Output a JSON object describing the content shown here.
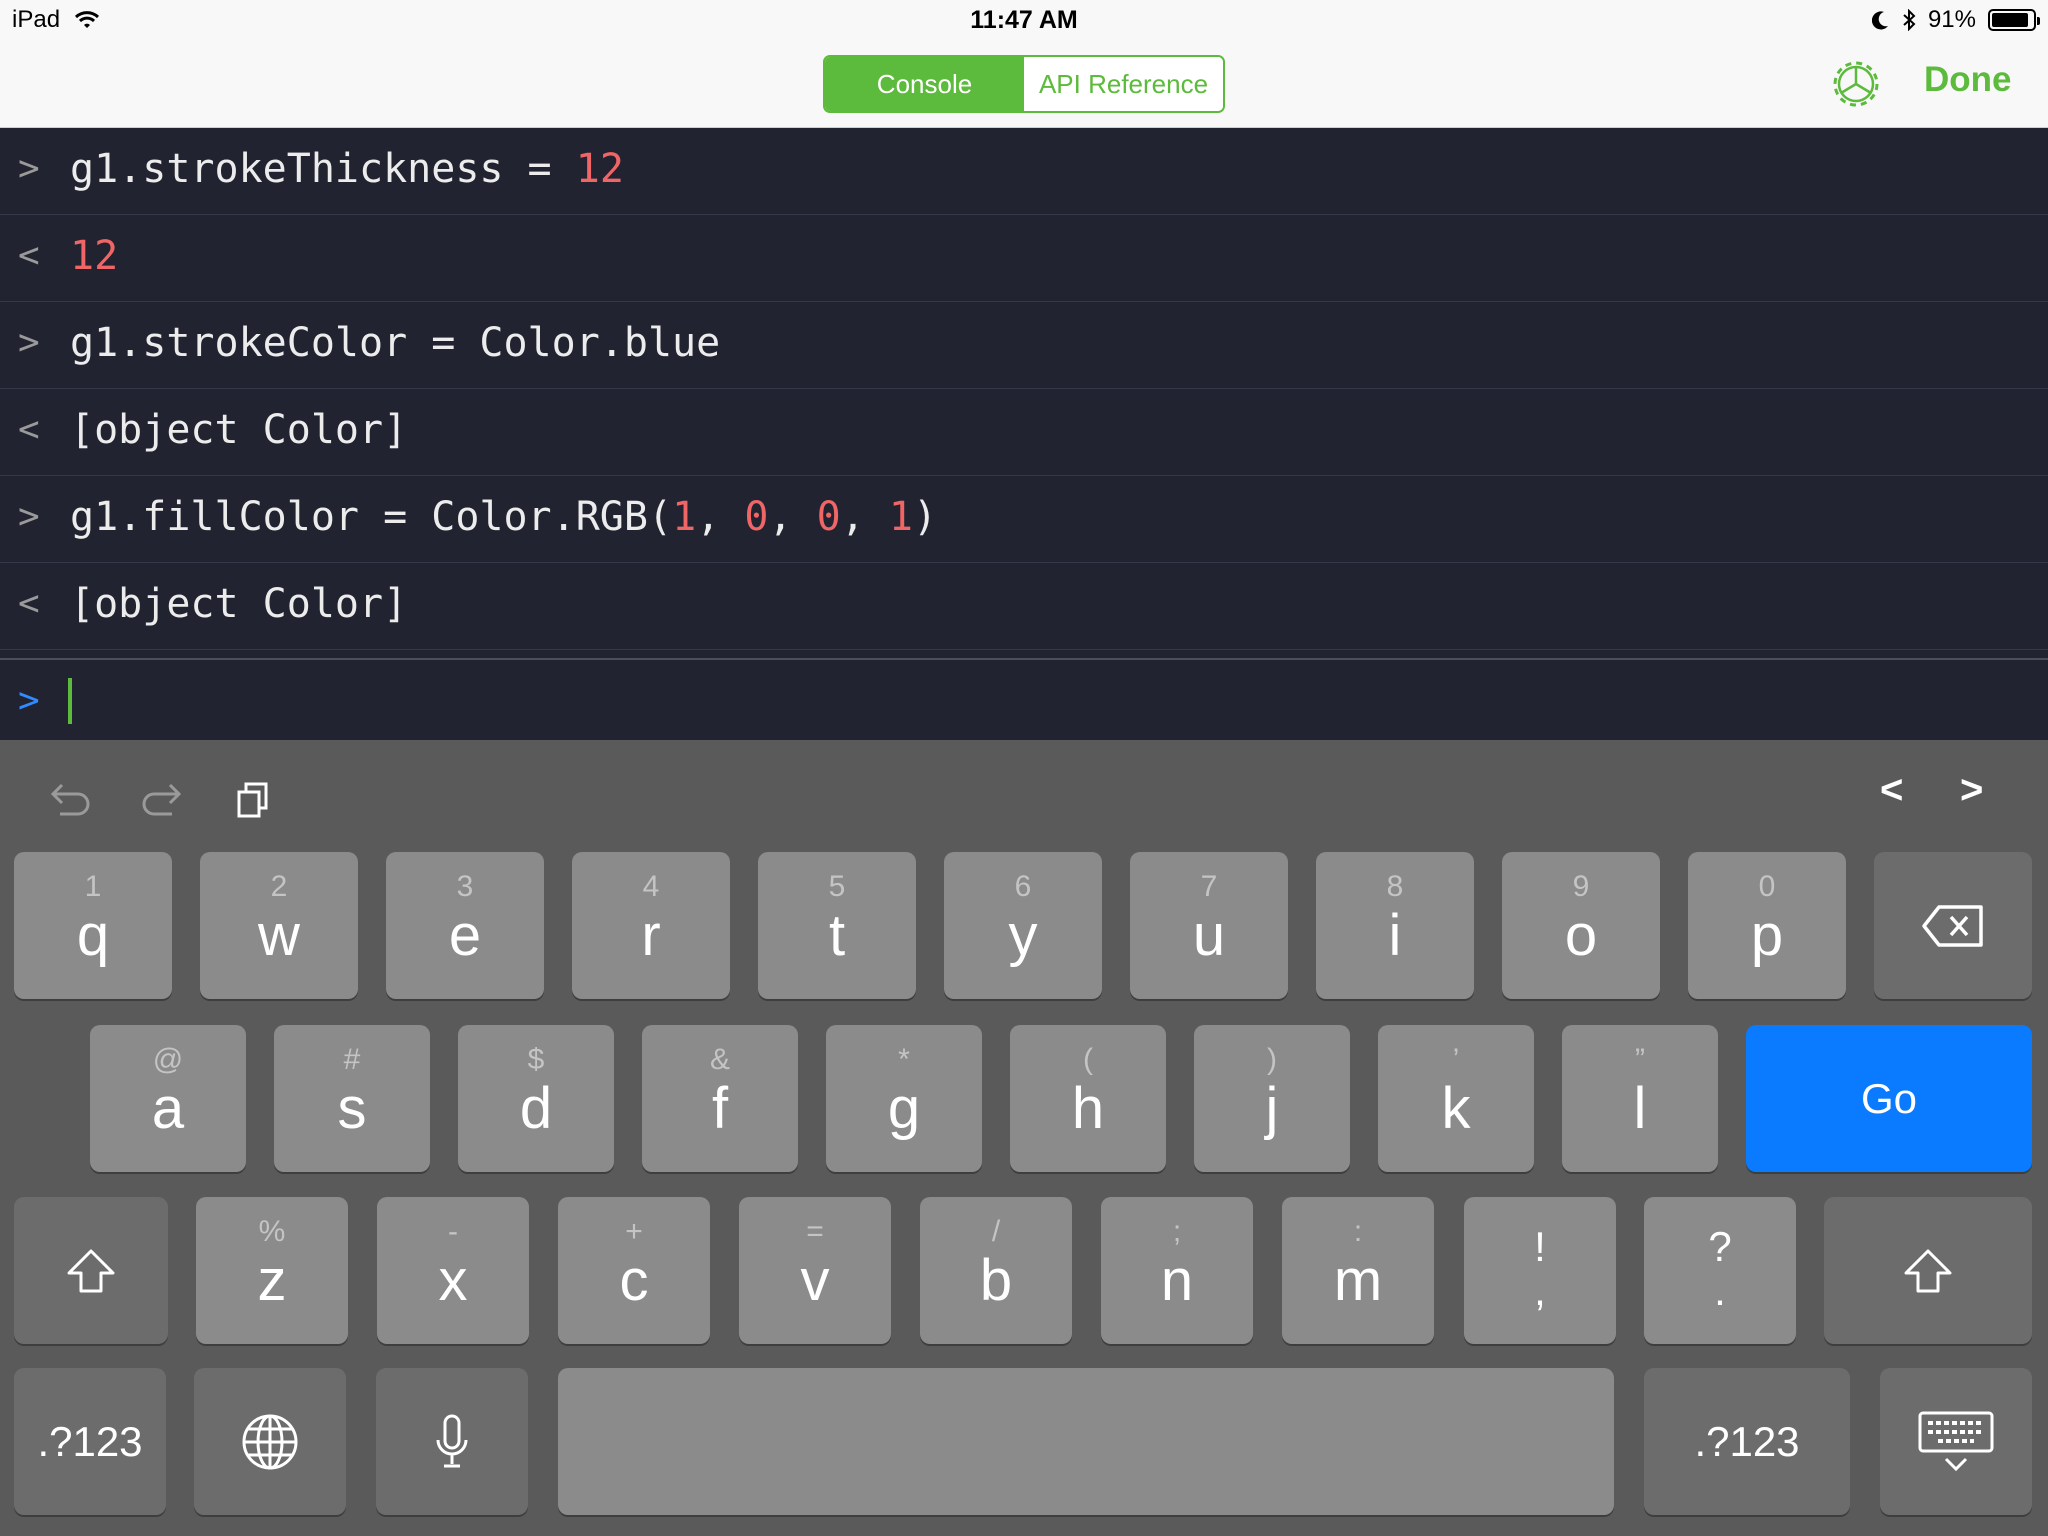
{
  "status_bar": {
    "device": "iPad",
    "time": "11:47 AM",
    "battery": "91%",
    "battery_level": 0.91
  },
  "nav": {
    "tabs": [
      "Console",
      "API Reference"
    ],
    "active_tab": "Console",
    "done": "Done"
  },
  "console": {
    "lines": [
      {
        "prefix": ">",
        "text": "g1.strokeThickness = ",
        "num": "12"
      },
      {
        "prefix": "<",
        "num": "12"
      },
      {
        "prefix": ">",
        "text": "g1.strokeColor = Color.blue"
      },
      {
        "prefix": "<",
        "text": "[object Color]"
      },
      {
        "prefix": ">",
        "text": "g1.fillColor = Color.RGB(",
        "n1": "1",
        "n2": "0",
        "n3": "0",
        "n4": "1"
      },
      {
        "prefix": "<",
        "text": "[object Color]"
      }
    ],
    "input_prompt": ">",
    "input_value": ""
  },
  "keyboard": {
    "toolbar": {
      "prev": "<",
      "next": ">"
    },
    "row1": [
      {
        "alt": "1",
        "key": "q"
      },
      {
        "alt": "2",
        "key": "w"
      },
      {
        "alt": "3",
        "key": "e"
      },
      {
        "alt": "4",
        "key": "r"
      },
      {
        "alt": "5",
        "key": "t"
      },
      {
        "alt": "6",
        "key": "y"
      },
      {
        "alt": "7",
        "key": "u"
      },
      {
        "alt": "8",
        "key": "i"
      },
      {
        "alt": "9",
        "key": "o"
      },
      {
        "alt": "0",
        "key": "p"
      }
    ],
    "row2": [
      {
        "alt": "@",
        "key": "a"
      },
      {
        "alt": "#",
        "key": "s"
      },
      {
        "alt": "$",
        "key": "d"
      },
      {
        "alt": "&",
        "key": "f"
      },
      {
        "alt": "*",
        "key": "g"
      },
      {
        "alt": "(",
        "key": "h"
      },
      {
        "alt": ")",
        "key": "j"
      },
      {
        "alt": "’",
        "key": "k"
      },
      {
        "alt": "”",
        "key": "l"
      }
    ],
    "go": "Go",
    "row3": [
      {
        "alt": "%",
        "key": "z"
      },
      {
        "alt": "-",
        "key": "x"
      },
      {
        "alt": "+",
        "key": "c"
      },
      {
        "alt": "=",
        "key": "v"
      },
      {
        "alt": "/",
        "key": "b"
      },
      {
        "alt": ";",
        "key": "n"
      },
      {
        "alt": ":",
        "key": "m"
      }
    ],
    "punct": [
      {
        "top": "!",
        "bottom": ","
      },
      {
        "top": "?",
        "bottom": "."
      }
    ],
    "numbers_label": ".?123",
    "colors": {
      "accent": "#5cba3c",
      "go": "#0a7aff",
      "num": "#f06565"
    }
  }
}
